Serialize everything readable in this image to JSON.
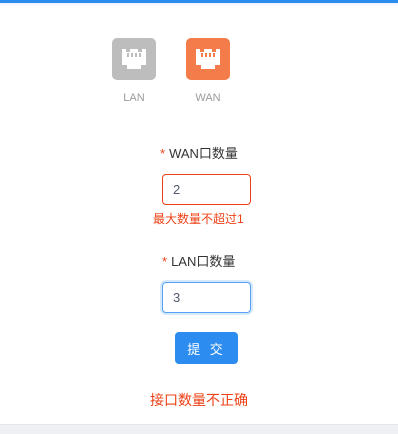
{
  "colors": {
    "accent": "#2d8cf0",
    "error": "#ed4014",
    "lan_icon": "#bdbdbd",
    "wan_icon": "#f47b4a"
  },
  "ports": [
    {
      "label": "LAN",
      "icon": "ethernet-port-icon",
      "selected": false
    },
    {
      "label": "WAN",
      "icon": "ethernet-port-icon",
      "selected": true
    }
  ],
  "form": {
    "required_mark": "*",
    "wan_count": {
      "label": "WAN口数量",
      "value": "2",
      "error": "最大数量不超过1"
    },
    "lan_count": {
      "label": "LAN口数量",
      "value": "3"
    },
    "submit_label": "提 交"
  },
  "message": "接口数量不正确"
}
